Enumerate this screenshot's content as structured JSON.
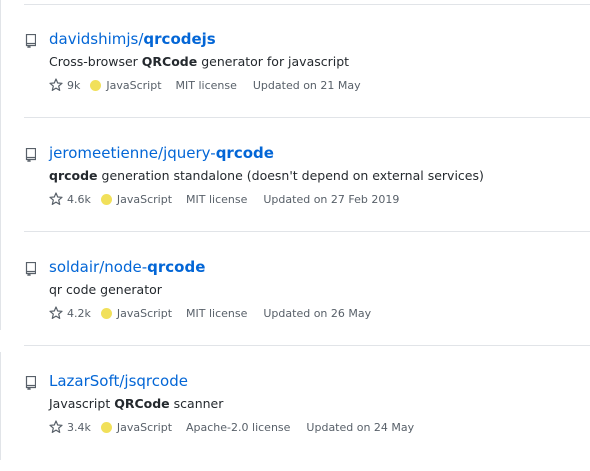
{
  "colors": {
    "link": "#0366d6",
    "javascript": "#f1e05a",
    "muted": "#586069",
    "border": "#e1e4e8"
  },
  "icons": {
    "repo": "repo-icon",
    "star": "star-icon"
  },
  "repos": [
    {
      "owner": "davidshimjs/",
      "name_plain": "",
      "name_bold": "qrcodejs",
      "desc_pre": "Cross-browser ",
      "desc_bold": "QRCode",
      "desc_post": " generator for javascript",
      "stars": "9k",
      "language": "JavaScript",
      "license": "MIT license",
      "updated": "Updated on 21 May"
    },
    {
      "owner": "jeromeetienne/",
      "name_plain": "jquery-",
      "name_bold": "qrcode",
      "desc_pre": "",
      "desc_bold": "qrcode",
      "desc_post": " generation standalone (doesn't depend on external services)",
      "stars": "4.6k",
      "language": "JavaScript",
      "license": "MIT license",
      "updated": "Updated on 27 Feb 2019"
    },
    {
      "owner": "soldair/",
      "name_plain": "node-",
      "name_bold": "qrcode",
      "desc_pre": "qr code generator",
      "desc_bold": "",
      "desc_post": "",
      "stars": "4.2k",
      "language": "JavaScript",
      "license": "MIT license",
      "updated": "Updated on 26 May"
    },
    {
      "owner": "LazarSoft/jsqrcode",
      "name_plain": "",
      "name_bold": "",
      "desc_pre": "Javascript ",
      "desc_bold": "QRCode",
      "desc_post": " scanner",
      "stars": "3.4k",
      "language": "JavaScript",
      "license": "Apache-2.0 license",
      "updated": "Updated on 24 May"
    }
  ]
}
